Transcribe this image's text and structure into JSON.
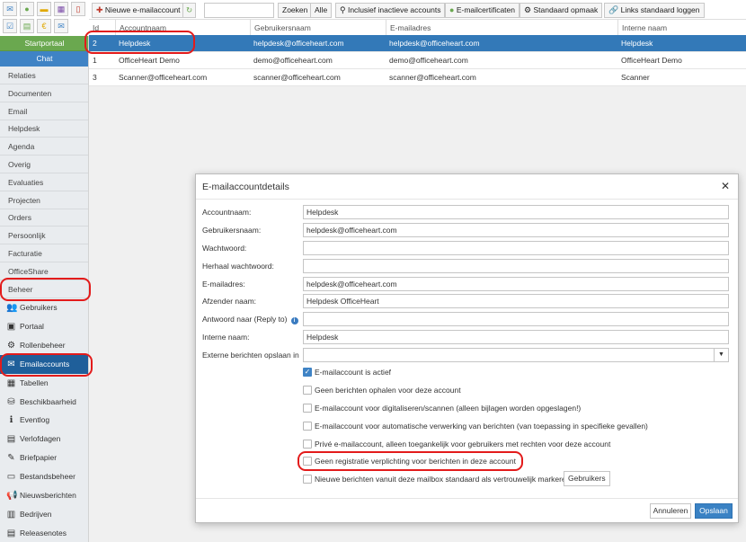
{
  "icon_grid": {
    "icons": [
      "checkbox-icon",
      "chat-bubble-icon",
      "note-icon",
      "calendar-icon",
      "document-icon",
      "checkbox-icon",
      "list-icon",
      "euro-icon",
      "mail-icon"
    ]
  },
  "sidebar": {
    "startportaal": "Startportaal",
    "chat": "Chat",
    "text_items": [
      "Relaties",
      "Documenten",
      "Email",
      "Helpdesk",
      "Agenda",
      "Overig",
      "Evaluaties",
      "Projecten",
      "Orders",
      "Persoonlijk",
      "Facturatie",
      "OfficeShare",
      "Beheer"
    ],
    "icon_items": [
      {
        "label": "Gebruikers",
        "icon": "users-icon",
        "glyph": "👥"
      },
      {
        "label": "Portaal",
        "icon": "portal-icon",
        "glyph": "▣"
      },
      {
        "label": "Rollenbeheer",
        "icon": "gear-icon",
        "glyph": "⚙"
      },
      {
        "label": "Emailaccounts",
        "icon": "envelope-icon",
        "glyph": "✉"
      },
      {
        "label": "Tabellen",
        "icon": "table-icon",
        "glyph": "▦"
      },
      {
        "label": "Beschikbaarheid",
        "icon": "database-icon",
        "glyph": "⛁"
      },
      {
        "label": "Eventlog",
        "icon": "info-icon",
        "glyph": "ℹ"
      },
      {
        "label": "Verlofdagen",
        "icon": "calendar-icon",
        "glyph": "▤"
      },
      {
        "label": "Briefpapier",
        "icon": "paper-icon",
        "glyph": "✎"
      },
      {
        "label": "Bestandsbeheer",
        "icon": "file-icon",
        "glyph": "▭"
      },
      {
        "label": "Nieuwsberichten",
        "icon": "megaphone-icon",
        "glyph": "📢"
      },
      {
        "label": "Bedrijven",
        "icon": "building-icon",
        "glyph": "▥"
      },
      {
        "label": "Releasenotes",
        "icon": "notes-icon",
        "glyph": "▤"
      }
    ]
  },
  "toolbar": {
    "new_account": "Nieuwe e-mailaccount",
    "search_value": "",
    "search": "Zoeken",
    "all": "Alle",
    "include_inactive": "Inclusief inactieve accounts",
    "certificates": "E-mailcertificaten",
    "default_layout": "Standaard opmaak",
    "default_links": "Links standaard loggen"
  },
  "table": {
    "headers": [
      "Id",
      "Accountnaam",
      "Gebruikersnaam",
      "E-mailadres",
      "Interne naam"
    ],
    "rows": [
      [
        "2",
        "Helpdesk",
        "helpdesk@officeheart.com",
        "helpdesk@officeheart.com",
        "Helpdesk"
      ],
      [
        "1",
        "OfficeHeart Demo",
        "demo@officeheart.com",
        "demo@officeheart.com",
        "OfficeHeart Demo"
      ],
      [
        "3",
        "Scanner@officeheart.com",
        "scanner@officeheart.com",
        "scanner@officeheart.com",
        "Scanner"
      ]
    ]
  },
  "modal": {
    "title": "E-mailaccountdetails",
    "fields": [
      {
        "label": "Accountnaam:",
        "value": "Helpdesk"
      },
      {
        "label": "Gebruikersnaam:",
        "value": "helpdesk@officeheart.com"
      },
      {
        "label": "Wachtwoord:",
        "value": ""
      },
      {
        "label": "Herhaal wachtwoord:",
        "value": ""
      },
      {
        "label": "E-mailadres:",
        "value": "helpdesk@officeheart.com"
      },
      {
        "label": "Afzender naam:",
        "value": "Helpdesk OfficeHeart"
      },
      {
        "label": "Antwoord naar (Reply to)",
        "value": ""
      },
      {
        "label": "Interne naam:",
        "value": "Helpdesk"
      }
    ],
    "folder_label": "Externe berichten opslaan in",
    "folder_value": "",
    "checkboxes": [
      {
        "label": "E-mailaccount is actief",
        "checked": true
      },
      {
        "label": "Geen berichten ophalen voor deze account",
        "checked": false
      },
      {
        "label": "E-mailaccount voor digitaliseren/scannen (alleen bijlagen worden opgeslagen!)",
        "checked": false
      },
      {
        "label": "E-mailaccount voor automatische verwerking van berichten (van toepassing in specifieke gevallen)",
        "checked": false
      },
      {
        "label": "Privé e-mailaccount, alleen toegankelijk voor gebruikers met rechten voor deze account",
        "checked": false
      },
      {
        "label": "Geen registratie verplichting voor berichten in deze account",
        "checked": false
      },
      {
        "label": "Nieuwe berichten vanuit deze mailbox standaard als vertrouwelijk markeren",
        "checked": false
      }
    ],
    "users_button": "Gebruikers",
    "cancel": "Annuleren",
    "save": "Opslaan"
  },
  "colors": {
    "accent": "#3379b8",
    "startportaal": "#6aa84f",
    "chat": "#3f83c5",
    "sidebar_active": "#1f5f9a",
    "annotation": "#e31b1b"
  }
}
